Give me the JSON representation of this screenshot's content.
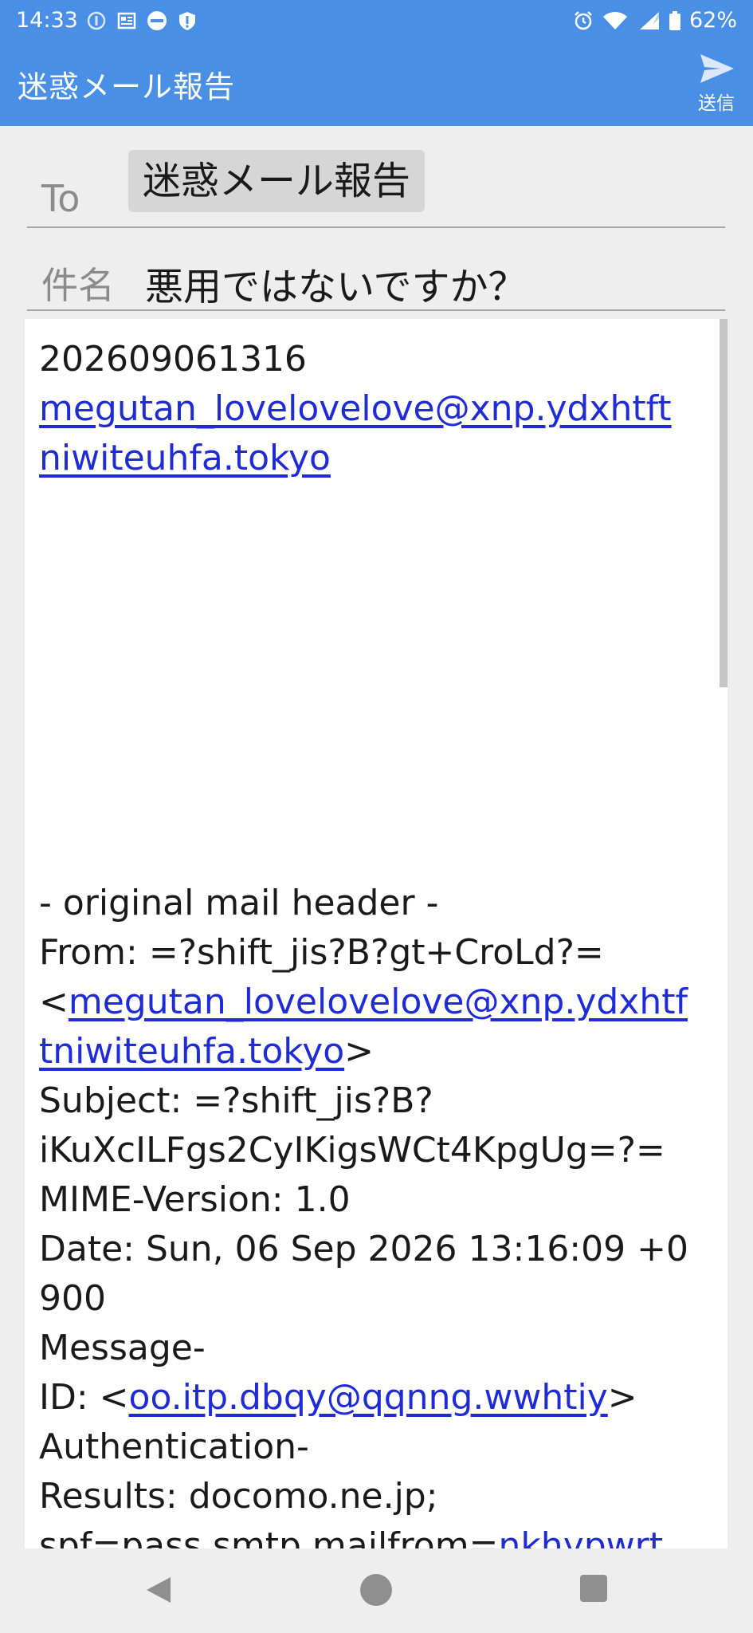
{
  "status_bar": {
    "time": "14:33",
    "battery": "62%",
    "icons": [
      "data-saver-icon",
      "news-app-icon",
      "cainz-app-icon",
      "shield-alert-icon",
      "alarm-icon",
      "wifi-icon",
      "signal-icon",
      "battery-icon"
    ]
  },
  "app_bar": {
    "title": "迷惑メール報告",
    "send_label": "送信"
  },
  "compose": {
    "to_label": "To",
    "to_chip": "迷惑メール報告",
    "subject_label": "件名",
    "subject_value": "悪用ではないですか？"
  },
  "body": {
    "lines": [
      "202609061316",
      "megutan_lovelovelove@xnp.ydxhtft",
      "niwiteuhfa.tokyo",
      "- original mail header -",
      "From: =?shift_jis?B?gt+CroLd?=",
      "<",
      "megutan_lovelovelove@xnp.ydxhtf",
      "tniwiteuhfa.tokyo",
      ">",
      "Subject: =?shift_jis?B?",
      "iKuXcILFgs2CyIKigsWCt4KpgUg=?=",
      "MIME-Version: 1.0",
      "Date: Sun, 06 Sep 2026 13:16:09 +0",
      "900",
      "Message-",
      "ID: <",
      "oo.itp.dbqy@qqnng.wwhtiy",
      ">",
      "Authentication-",
      "Results: docomo.ne.jp;",
      " spf=pass smtp.mailfrom=",
      "nkhypwrt"
    ]
  },
  "colors": {
    "app_bar": "#4a8fe6",
    "link": "#1f2bd4",
    "chip": "#d6d6d6",
    "label_gray": "#8b8b8b"
  }
}
